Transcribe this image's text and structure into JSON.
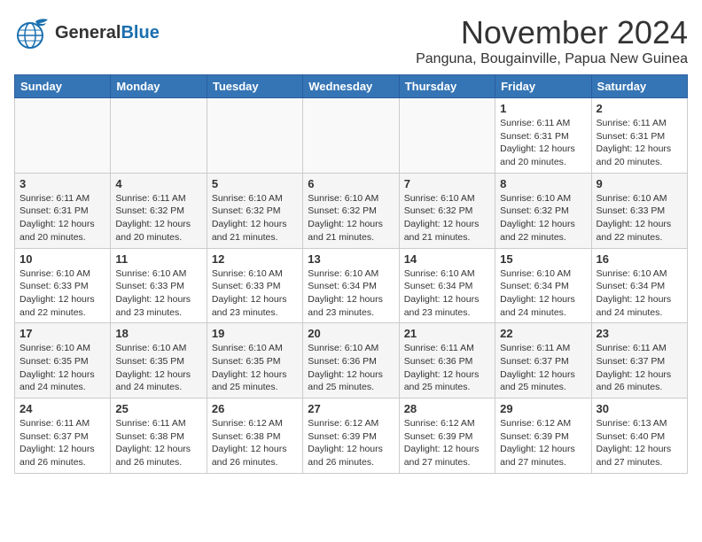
{
  "header": {
    "logo_general": "General",
    "logo_blue": "Blue",
    "month": "November 2024",
    "location": "Panguna, Bougainville, Papua New Guinea"
  },
  "days_of_week": [
    "Sunday",
    "Monday",
    "Tuesday",
    "Wednesday",
    "Thursday",
    "Friday",
    "Saturday"
  ],
  "weeks": [
    [
      {
        "day": "",
        "info": ""
      },
      {
        "day": "",
        "info": ""
      },
      {
        "day": "",
        "info": ""
      },
      {
        "day": "",
        "info": ""
      },
      {
        "day": "",
        "info": ""
      },
      {
        "day": "1",
        "info": "Sunrise: 6:11 AM\nSunset: 6:31 PM\nDaylight: 12 hours\nand 20 minutes."
      },
      {
        "day": "2",
        "info": "Sunrise: 6:11 AM\nSunset: 6:31 PM\nDaylight: 12 hours\nand 20 minutes."
      }
    ],
    [
      {
        "day": "3",
        "info": "Sunrise: 6:11 AM\nSunset: 6:31 PM\nDaylight: 12 hours\nand 20 minutes."
      },
      {
        "day": "4",
        "info": "Sunrise: 6:11 AM\nSunset: 6:32 PM\nDaylight: 12 hours\nand 20 minutes."
      },
      {
        "day": "5",
        "info": "Sunrise: 6:10 AM\nSunset: 6:32 PM\nDaylight: 12 hours\nand 21 minutes."
      },
      {
        "day": "6",
        "info": "Sunrise: 6:10 AM\nSunset: 6:32 PM\nDaylight: 12 hours\nand 21 minutes."
      },
      {
        "day": "7",
        "info": "Sunrise: 6:10 AM\nSunset: 6:32 PM\nDaylight: 12 hours\nand 21 minutes."
      },
      {
        "day": "8",
        "info": "Sunrise: 6:10 AM\nSunset: 6:32 PM\nDaylight: 12 hours\nand 22 minutes."
      },
      {
        "day": "9",
        "info": "Sunrise: 6:10 AM\nSunset: 6:33 PM\nDaylight: 12 hours\nand 22 minutes."
      }
    ],
    [
      {
        "day": "10",
        "info": "Sunrise: 6:10 AM\nSunset: 6:33 PM\nDaylight: 12 hours\nand 22 minutes."
      },
      {
        "day": "11",
        "info": "Sunrise: 6:10 AM\nSunset: 6:33 PM\nDaylight: 12 hours\nand 23 minutes."
      },
      {
        "day": "12",
        "info": "Sunrise: 6:10 AM\nSunset: 6:33 PM\nDaylight: 12 hours\nand 23 minutes."
      },
      {
        "day": "13",
        "info": "Sunrise: 6:10 AM\nSunset: 6:34 PM\nDaylight: 12 hours\nand 23 minutes."
      },
      {
        "day": "14",
        "info": "Sunrise: 6:10 AM\nSunset: 6:34 PM\nDaylight: 12 hours\nand 23 minutes."
      },
      {
        "day": "15",
        "info": "Sunrise: 6:10 AM\nSunset: 6:34 PM\nDaylight: 12 hours\nand 24 minutes."
      },
      {
        "day": "16",
        "info": "Sunrise: 6:10 AM\nSunset: 6:34 PM\nDaylight: 12 hours\nand 24 minutes."
      }
    ],
    [
      {
        "day": "17",
        "info": "Sunrise: 6:10 AM\nSunset: 6:35 PM\nDaylight: 12 hours\nand 24 minutes."
      },
      {
        "day": "18",
        "info": "Sunrise: 6:10 AM\nSunset: 6:35 PM\nDaylight: 12 hours\nand 24 minutes."
      },
      {
        "day": "19",
        "info": "Sunrise: 6:10 AM\nSunset: 6:35 PM\nDaylight: 12 hours\nand 25 minutes."
      },
      {
        "day": "20",
        "info": "Sunrise: 6:10 AM\nSunset: 6:36 PM\nDaylight: 12 hours\nand 25 minutes."
      },
      {
        "day": "21",
        "info": "Sunrise: 6:11 AM\nSunset: 6:36 PM\nDaylight: 12 hours\nand 25 minutes."
      },
      {
        "day": "22",
        "info": "Sunrise: 6:11 AM\nSunset: 6:37 PM\nDaylight: 12 hours\nand 25 minutes."
      },
      {
        "day": "23",
        "info": "Sunrise: 6:11 AM\nSunset: 6:37 PM\nDaylight: 12 hours\nand 26 minutes."
      }
    ],
    [
      {
        "day": "24",
        "info": "Sunrise: 6:11 AM\nSunset: 6:37 PM\nDaylight: 12 hours\nand 26 minutes."
      },
      {
        "day": "25",
        "info": "Sunrise: 6:11 AM\nSunset: 6:38 PM\nDaylight: 12 hours\nand 26 minutes."
      },
      {
        "day": "26",
        "info": "Sunrise: 6:12 AM\nSunset: 6:38 PM\nDaylight: 12 hours\nand 26 minutes."
      },
      {
        "day": "27",
        "info": "Sunrise: 6:12 AM\nSunset: 6:39 PM\nDaylight: 12 hours\nand 26 minutes."
      },
      {
        "day": "28",
        "info": "Sunrise: 6:12 AM\nSunset: 6:39 PM\nDaylight: 12 hours\nand 27 minutes."
      },
      {
        "day": "29",
        "info": "Sunrise: 6:12 AM\nSunset: 6:39 PM\nDaylight: 12 hours\nand 27 minutes."
      },
      {
        "day": "30",
        "info": "Sunrise: 6:13 AM\nSunset: 6:40 PM\nDaylight: 12 hours\nand 27 minutes."
      }
    ]
  ]
}
